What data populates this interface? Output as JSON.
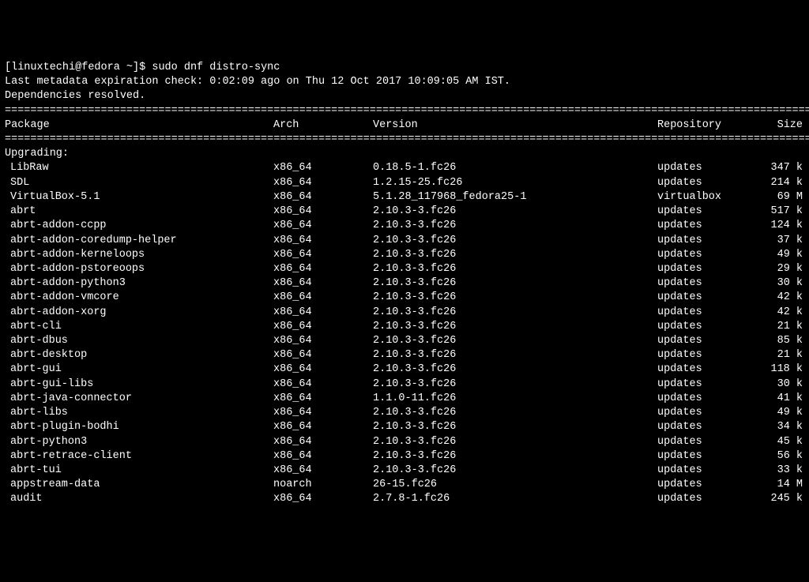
{
  "prompt": "[linuxtechi@fedora ~]$ ",
  "command": "sudo dnf distro-sync",
  "metadata_line": "Last metadata expiration check: 0:02:09 ago on Thu 12 Oct 2017 10:09:05 AM IST.",
  "deps_line": "Dependencies resolved.",
  "separator": "===================================================================================================================================",
  "headers": {
    "package": "Package",
    "arch": "Arch",
    "version": "Version",
    "repository": "Repository",
    "size": "Size"
  },
  "section": "Upgrading:",
  "packages": [
    {
      "name": "LibRaw",
      "arch": "x86_64",
      "version": "0.18.5-1.fc26",
      "repo": "updates",
      "size": "347 k"
    },
    {
      "name": "SDL",
      "arch": "x86_64",
      "version": "1.2.15-25.fc26",
      "repo": "updates",
      "size": "214 k"
    },
    {
      "name": "VirtualBox-5.1",
      "arch": "x86_64",
      "version": "5.1.28_117968_fedora25-1",
      "repo": "virtualbox",
      "size": "69 M"
    },
    {
      "name": "abrt",
      "arch": "x86_64",
      "version": "2.10.3-3.fc26",
      "repo": "updates",
      "size": "517 k"
    },
    {
      "name": "abrt-addon-ccpp",
      "arch": "x86_64",
      "version": "2.10.3-3.fc26",
      "repo": "updates",
      "size": "124 k"
    },
    {
      "name": "abrt-addon-coredump-helper",
      "arch": "x86_64",
      "version": "2.10.3-3.fc26",
      "repo": "updates",
      "size": "37 k"
    },
    {
      "name": "abrt-addon-kerneloops",
      "arch": "x86_64",
      "version": "2.10.3-3.fc26",
      "repo": "updates",
      "size": "49 k"
    },
    {
      "name": "abrt-addon-pstoreoops",
      "arch": "x86_64",
      "version": "2.10.3-3.fc26",
      "repo": "updates",
      "size": "29 k"
    },
    {
      "name": "abrt-addon-python3",
      "arch": "x86_64",
      "version": "2.10.3-3.fc26",
      "repo": "updates",
      "size": "30 k"
    },
    {
      "name": "abrt-addon-vmcore",
      "arch": "x86_64",
      "version": "2.10.3-3.fc26",
      "repo": "updates",
      "size": "42 k"
    },
    {
      "name": "abrt-addon-xorg",
      "arch": "x86_64",
      "version": "2.10.3-3.fc26",
      "repo": "updates",
      "size": "42 k"
    },
    {
      "name": "abrt-cli",
      "arch": "x86_64",
      "version": "2.10.3-3.fc26",
      "repo": "updates",
      "size": "21 k"
    },
    {
      "name": "abrt-dbus",
      "arch": "x86_64",
      "version": "2.10.3-3.fc26",
      "repo": "updates",
      "size": "85 k"
    },
    {
      "name": "abrt-desktop",
      "arch": "x86_64",
      "version": "2.10.3-3.fc26",
      "repo": "updates",
      "size": "21 k"
    },
    {
      "name": "abrt-gui",
      "arch": "x86_64",
      "version": "2.10.3-3.fc26",
      "repo": "updates",
      "size": "118 k"
    },
    {
      "name": "abrt-gui-libs",
      "arch": "x86_64",
      "version": "2.10.3-3.fc26",
      "repo": "updates",
      "size": "30 k"
    },
    {
      "name": "abrt-java-connector",
      "arch": "x86_64",
      "version": "1.1.0-11.fc26",
      "repo": "updates",
      "size": "41 k"
    },
    {
      "name": "abrt-libs",
      "arch": "x86_64",
      "version": "2.10.3-3.fc26",
      "repo": "updates",
      "size": "49 k"
    },
    {
      "name": "abrt-plugin-bodhi",
      "arch": "x86_64",
      "version": "2.10.3-3.fc26",
      "repo": "updates",
      "size": "34 k"
    },
    {
      "name": "abrt-python3",
      "arch": "x86_64",
      "version": "2.10.3-3.fc26",
      "repo": "updates",
      "size": "45 k"
    },
    {
      "name": "abrt-retrace-client",
      "arch": "x86_64",
      "version": "2.10.3-3.fc26",
      "repo": "updates",
      "size": "56 k"
    },
    {
      "name": "abrt-tui",
      "arch": "x86_64",
      "version": "2.10.3-3.fc26",
      "repo": "updates",
      "size": "33 k"
    },
    {
      "name": "appstream-data",
      "arch": "noarch",
      "version": "26-15.fc26",
      "repo": "updates",
      "size": "14 M"
    },
    {
      "name": "audit",
      "arch": "x86_64",
      "version": "2.7.8-1.fc26",
      "repo": "updates",
      "size": "245 k"
    }
  ]
}
